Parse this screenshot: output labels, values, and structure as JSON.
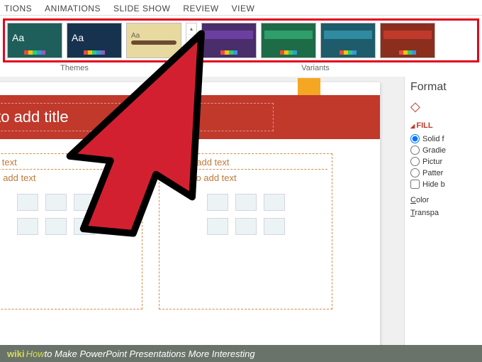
{
  "ribbon": {
    "tabs": [
      "TIONS",
      "ANIMATIONS",
      "SLIDE SHOW",
      "REVIEW",
      "VIEW"
    ]
  },
  "gallery": {
    "themes_label": "Themes",
    "variants_label": "Variants",
    "aa": "Aa"
  },
  "slide": {
    "title_placeholder": "ck to add title",
    "left": {
      "header": "to add text",
      "bullet": "ck to add text"
    },
    "right": {
      "header": "Click to add text",
      "bullet": "Click to add text"
    }
  },
  "format": {
    "title": "Format",
    "fill_section": "FILL",
    "options": {
      "solid": "Solid f",
      "gradient": "Gradie",
      "picture": "Pictur",
      "pattern": "Patter",
      "hide": "Hide b"
    },
    "color_link": "Color",
    "transparency_link": "Transpa"
  },
  "caption": {
    "brand_prefix": "wiki",
    "brand_suffix": "How",
    "text": " to Make PowerPoint Presentations More Interesting"
  }
}
